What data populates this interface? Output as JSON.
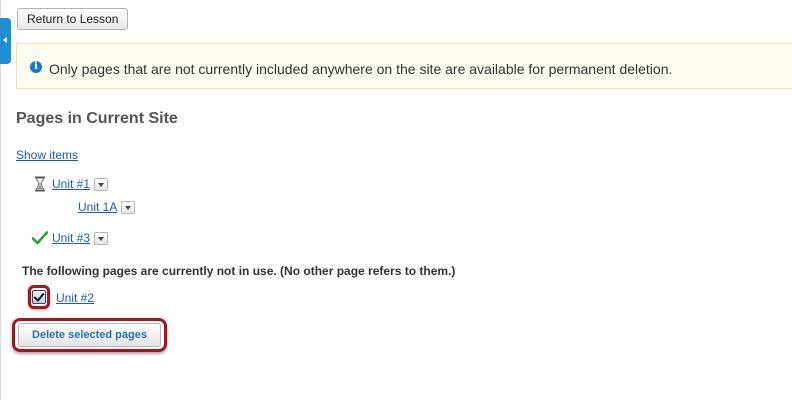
{
  "toolbar": {
    "return_label": "Return to Lesson"
  },
  "info": {
    "message": "Only pages that are not currently included anywhere on the site are available for permanent deletion."
  },
  "section": {
    "title": "Pages in Current Site",
    "show_items_label": "Show items"
  },
  "pages": [
    {
      "label": "Unit #1",
      "status_icon": "hourglass-icon"
    },
    {
      "label": "Unit 1A",
      "status_icon": ""
    },
    {
      "label": "Unit #3",
      "status_icon": "checkmark-icon"
    }
  ],
  "unused": {
    "note": "The following pages are currently not in use. (No other page refers to them.)",
    "items": [
      {
        "label": "Unit #2",
        "checked": true
      }
    ]
  },
  "actions": {
    "delete_label": "Delete selected pages"
  },
  "colors": {
    "accent": "#1e8fd4",
    "link": "#1a5bc4",
    "highlight": "#a3161b",
    "notice_bg": "#fdfbee",
    "success": "#3a9a3a"
  }
}
